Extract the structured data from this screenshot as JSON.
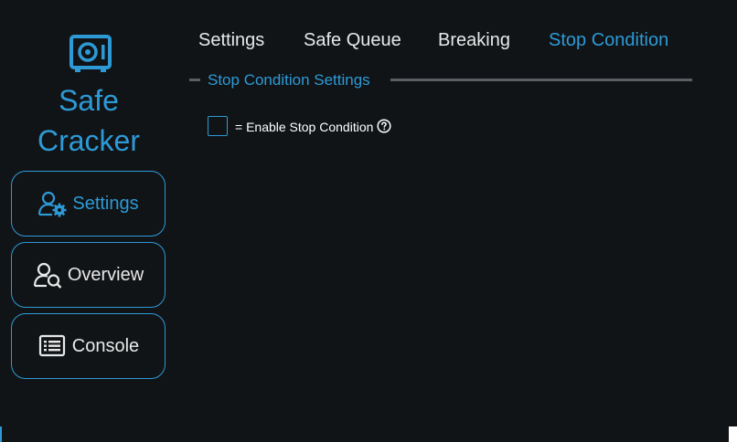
{
  "app": {
    "title_line1": "Safe",
    "title_line2": "Cracker",
    "logo_icon": "safe-icon",
    "accent_color": "#2d9ad6",
    "background_color": "#111417"
  },
  "sidebar": {
    "items": [
      {
        "label": "Settings",
        "icon": "user-gear-icon",
        "active": true
      },
      {
        "label": "Overview",
        "icon": "user-search-icon",
        "active": false
      },
      {
        "label": "Console",
        "icon": "list-icon",
        "active": false
      }
    ]
  },
  "tabs": [
    {
      "label": "Settings",
      "active": false
    },
    {
      "label": "Safe Queue",
      "active": false
    },
    {
      "label": "Breaking",
      "active": false
    },
    {
      "label": "Stop Condition",
      "active": true
    }
  ],
  "section": {
    "title": "Stop Condition Settings"
  },
  "options": {
    "enable_stop_condition": {
      "label": "= Enable Stop Condition",
      "checked": false,
      "help_icon": "help-circle-icon"
    }
  }
}
